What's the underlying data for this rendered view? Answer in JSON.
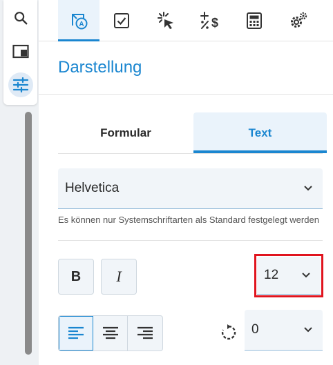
{
  "rail": {
    "buttons": [
      {
        "icon": "search-icon"
      },
      {
        "icon": "panel-icon"
      },
      {
        "icon": "sliders-icon",
        "active": true
      }
    ]
  },
  "toolbar": {
    "tabs": [
      {
        "icon": "text-style-icon",
        "active": true
      },
      {
        "icon": "checkbox-icon"
      },
      {
        "icon": "cursor-click-icon"
      },
      {
        "icon": "calculation-icon"
      },
      {
        "icon": "calculator-icon"
      },
      {
        "icon": "gears-icon"
      }
    ]
  },
  "section": {
    "title": "Darstellung"
  },
  "mode_tabs": [
    {
      "label": "Formular",
      "active": false
    },
    {
      "label": "Text",
      "active": true
    }
  ],
  "font": {
    "family": "Helvetica",
    "hint": "Es können nur Systemschriftarten als Standard festgelegt werden",
    "size": "12",
    "bold_label": "B",
    "italic_label": "I"
  },
  "alignment": {
    "options": [
      "left",
      "center",
      "right"
    ],
    "selected": "left"
  },
  "rotation": {
    "value": "0"
  },
  "colors": {
    "accent": "#1a86d0",
    "highlight": "#e0141e",
    "field_bg": "#f1f5f9"
  }
}
